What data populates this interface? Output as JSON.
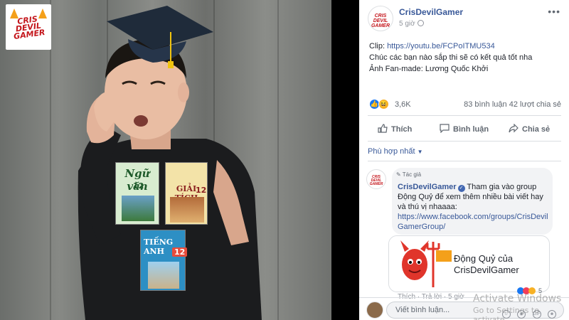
{
  "post": {
    "author": "CrisDevilGamer",
    "time": "5 giờ",
    "clip_label": "Clip: ",
    "clip_url": "https://youtu.be/FCPoITMU534",
    "line2": "Chúc các bạn nào sắp thi sẽ có kết quả tốt nha",
    "line3": "Ảnh Fan-made: Lương Quốc Khởi",
    "more_icon": "more-icon"
  },
  "logo": {
    "line1": "CRIS",
    "line2": "DEVIL",
    "line3": "GAMER"
  },
  "books": {
    "ngu_van": {
      "title": "Ngữ văn",
      "number": "12"
    },
    "giai_tich": {
      "title": "GIẢI TÍCH",
      "number": "12"
    },
    "tieng_anh": {
      "title": "TIẾNG ANH",
      "number": "12"
    }
  },
  "reactions": {
    "count": "3,6K",
    "comments": "83 bình luận",
    "shares": "42 lượt chia sẻ",
    "like_color": "#1877f2",
    "haha_color": "#f7b125"
  },
  "actions": {
    "like": "Thích",
    "comment": "Bình luận",
    "share": "Chia sẻ"
  },
  "sort": {
    "label": "Phù hợp nhất"
  },
  "comment": {
    "tag": "Tác giả",
    "author": "CrisDevilGamer",
    "text_after_author": " Tham gia vào group Động Quỷ để xem thêm nhiều bài viết hay và thú vị nhaaaa:",
    "link": "https://www.facebook.com/groups/CrisDevilGamerGroup/",
    "card_title": "Động Quỷ của CrisDevilGamer",
    "react_count": "5",
    "meta": "Thích · Trả lời · 5 giờ"
  },
  "composer": {
    "placeholder": "Viết bình luận..."
  },
  "watermark": {
    "line1": "Activate Windows",
    "line2": "Go to Settings to activate"
  }
}
